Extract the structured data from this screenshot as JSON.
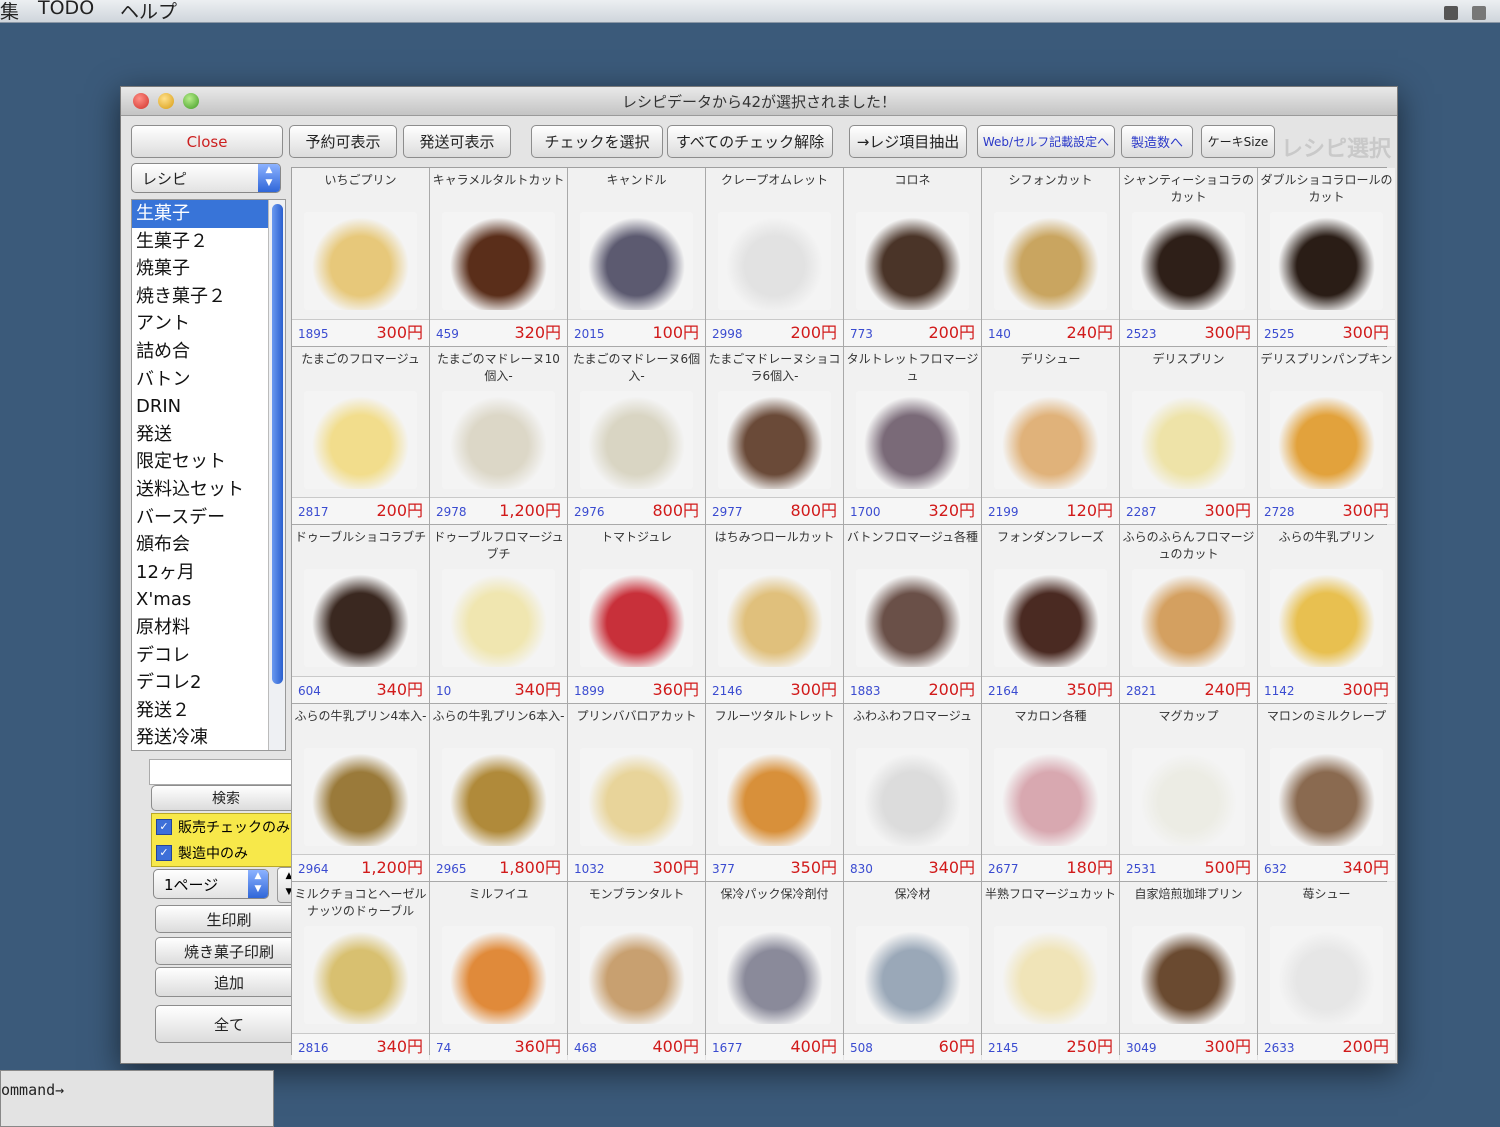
{
  "menubar": {
    "items": [
      "集",
      "TODO",
      "ヘルプ"
    ]
  },
  "window": {
    "title": "レシピデータから42が選択されました！",
    "heading": "レシピ選択"
  },
  "toolbar": {
    "close": "Close",
    "reservable": "予約可表示",
    "shippable": "発送可表示",
    "select_checked": "チェックを選択",
    "clear_checks": "すべてのチェック解除",
    "extract": "→レジ項目抽出",
    "web_settings": "Web/セルフ記載設定へ",
    "production": "製造数へ",
    "cake_size": "ケーキSize"
  },
  "sidebar": {
    "category_popup": "レシピ",
    "categories": [
      "生菓子",
      "生菓子２",
      "焼菓子",
      "焼き菓子２",
      "アント",
      "詰め合",
      "バトン",
      "DRIN",
      "発送",
      "限定セット",
      "送料込セット",
      "バースデー",
      "頒布会",
      "12ヶ月",
      "X'mas",
      "原材料",
      "デコレ",
      "デコレ2",
      "発送２",
      "発送冷凍"
    ],
    "selected_index": 0,
    "search_button": "検索",
    "check_sales": "販売チェックのみ",
    "check_production": "製造中のみ",
    "page_popup": "1ページ",
    "print_fresh": "生印刷",
    "print_baked": "焼き菓子印刷",
    "add": "追加",
    "all": "全て"
  },
  "products": [
    {
      "name": "いちごプリン",
      "id": "1895",
      "price": "300円",
      "color": "#e7c87a"
    },
    {
      "name": "キャラメルタルトカット",
      "id": "459",
      "price": "320円",
      "color": "#5a2e1a"
    },
    {
      "name": "キャンドル",
      "id": "2015",
      "price": "100円",
      "color": "#5c5a70"
    },
    {
      "name": "クレープオムレット",
      "id": "2998",
      "price": "200円",
      "color": "#e2e2e2"
    },
    {
      "name": "コロネ",
      "id": "773",
      "price": "200円",
      "color": "#4a3428"
    },
    {
      "name": "シフォンカット",
      "id": "140",
      "price": "240円",
      "color": "#c9a560"
    },
    {
      "name": "シャンティーショコラのカット",
      "id": "2523",
      "price": "300円",
      "color": "#2e1f18"
    },
    {
      "name": "ダブルショコラロールのカット",
      "id": "2525",
      "price": "300円",
      "color": "#2a1d16"
    },
    {
      "name": "たまごのフロマージュ",
      "id": "2817",
      "price": "200円",
      "color": "#f2dd8c"
    },
    {
      "name": "たまごのマドレーヌ10個入-",
      "id": "2978",
      "price": "1,200円",
      "color": "#dcd7c7"
    },
    {
      "name": "たまごのマドレーヌ6個入-",
      "id": "2976",
      "price": "800円",
      "color": "#d9d5c3"
    },
    {
      "name": "たまごマドレーヌショコラ6個入-",
      "id": "2977",
      "price": "800円",
      "color": "#6a4a38"
    },
    {
      "name": "タルトレットフロマージュ",
      "id": "1700",
      "price": "320円",
      "color": "#7a6a78"
    },
    {
      "name": "デリシュー",
      "id": "2199",
      "price": "120円",
      "color": "#e0b27a"
    },
    {
      "name": "デリスプリン",
      "id": "2287",
      "price": "300円",
      "color": "#eee3a8"
    },
    {
      "name": "デリスプリンパンプキン",
      "id": "2728",
      "price": "300円",
      "color": "#e2a23c"
    },
    {
      "name": "ドゥーブルショコラブチ",
      "id": "604",
      "price": "340円",
      "color": "#3a2820"
    },
    {
      "name": "ドゥーブルフロマージュブチ",
      "id": "10",
      "price": "340円",
      "color": "#f0e6b0"
    },
    {
      "name": "トマトジュレ",
      "id": "1899",
      "price": "360円",
      "color": "#c8303a"
    },
    {
      "name": "はちみつロールカット",
      "id": "2146",
      "price": "300円",
      "color": "#e0c07c"
    },
    {
      "name": "バトンフロマージュ各種",
      "id": "1883",
      "price": "200円",
      "color": "#6a5048"
    },
    {
      "name": "フォンダンフレーズ",
      "id": "2164",
      "price": "350円",
      "color": "#4a2a22"
    },
    {
      "name": "ふらのふらんフロマージュのカット",
      "id": "2821",
      "price": "240円",
      "color": "#d4a060"
    },
    {
      "name": "ふらの牛乳プリン",
      "id": "1142",
      "price": "300円",
      "color": "#e8c050"
    },
    {
      "name": "ふらの牛乳プリン4本入-",
      "id": "2964",
      "price": "1,200円",
      "color": "#9a7a3a"
    },
    {
      "name": "ふらの牛乳プリン6本入-",
      "id": "2965",
      "price": "1,800円",
      "color": "#b08a3a"
    },
    {
      "name": "プリンババロアカット",
      "id": "1032",
      "price": "300円",
      "color": "#e8d49a"
    },
    {
      "name": "フルーツタルトレット",
      "id": "377",
      "price": "350円",
      "color": "#d8903a"
    },
    {
      "name": "ふわふわフロマージュ",
      "id": "830",
      "price": "340円",
      "color": "#dcdcdc"
    },
    {
      "name": "マカロン各種",
      "id": "2677",
      "price": "180円",
      "color": "#d8a8b0"
    },
    {
      "name": "マグカップ",
      "id": "2531",
      "price": "500円",
      "color": "#ecece4"
    },
    {
      "name": "マロンのミルクレープ",
      "id": "632",
      "price": "340円",
      "color": "#8a6a50"
    },
    {
      "name": "ミルクチョコとヘーゼルナッツのドゥーブル",
      "id": "2816",
      "price": "340円",
      "color": "#d8c070"
    },
    {
      "name": "ミルフイユ",
      "id": "74",
      "price": "360円",
      "color": "#e08a3a"
    },
    {
      "name": "モンブランタルト",
      "id": "468",
      "price": "400円",
      "color": "#c8a070"
    },
    {
      "name": "保冷パック保冷剤付",
      "id": "1677",
      "price": "400円",
      "color": "#8a8a9a"
    },
    {
      "name": "保冷材",
      "id": "508",
      "price": "60円",
      "color": "#9aa8b8"
    },
    {
      "name": "半熟フロマージュカット",
      "id": "2145",
      "price": "250円",
      "color": "#f0e4b8"
    },
    {
      "name": "自家焙煎珈琲プリン",
      "id": "3049",
      "price": "300円",
      "color": "#6a4a30"
    },
    {
      "name": "苺シュー",
      "id": "2633",
      "price": "200円",
      "color": "#e6e6e6"
    }
  ],
  "terminal": {
    "text": "ommand→"
  }
}
